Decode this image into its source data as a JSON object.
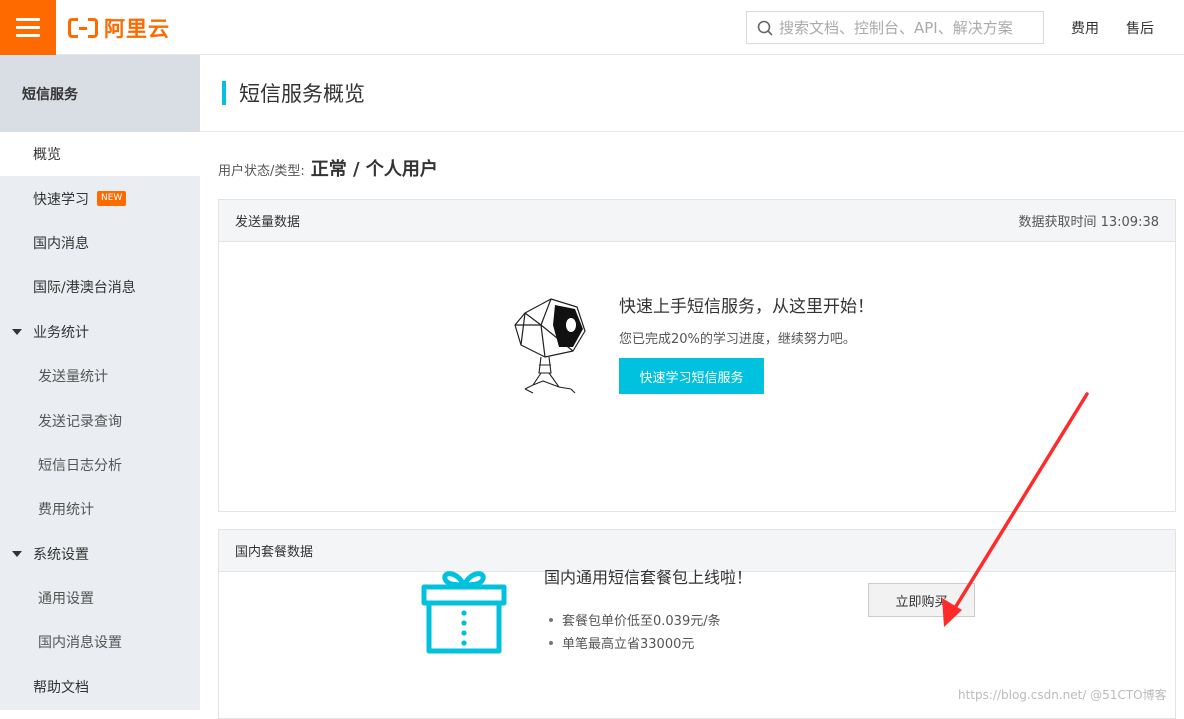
{
  "header": {
    "logo_text": "阿里云",
    "search_placeholder": "搜索文档、控制台、API、解决方案",
    "links": [
      "费用",
      "售后"
    ]
  },
  "sidebar": {
    "title": "短信服务",
    "items": [
      {
        "label": "概览"
      },
      {
        "label": "快速学习",
        "badge": "NEW"
      },
      {
        "label": "国内消息"
      },
      {
        "label": "国际/港澳台消息"
      },
      {
        "label": "业务统计"
      },
      {
        "label": "发送量统计"
      },
      {
        "label": "发送记录查询"
      },
      {
        "label": "短信日志分析"
      },
      {
        "label": "费用统计"
      },
      {
        "label": "系统设置"
      },
      {
        "label": "通用设置"
      },
      {
        "label": "国内消息设置"
      },
      {
        "label": "帮助文档"
      }
    ]
  },
  "main": {
    "page_title": "短信服务概览",
    "user_status_label": "用户状态/类型:",
    "user_status_value": "正常 / 个人用户",
    "send_panel": {
      "title": "发送量数据",
      "time_label": "数据获取时间 13:09:38",
      "onboarding_title": "快速上手短信服务，从这里开始！",
      "onboarding_sub": "您已完成20%的学习进度，继续努力吧。",
      "onboarding_button": "快速学习短信服务"
    },
    "package_panel": {
      "title": "国内套餐数据",
      "promo_title": "国内通用短信套餐包上线啦！",
      "points": [
        "套餐包单价低至0.039元/条",
        "单笔最高立省33000元"
      ],
      "buy_button": "立即购买"
    }
  },
  "watermark": "https://blog.csdn.net/ @51CTO博客",
  "colors": {
    "brand": "#ff6a00",
    "accent": "#00c1de",
    "arrow": "#ff2a2a"
  }
}
